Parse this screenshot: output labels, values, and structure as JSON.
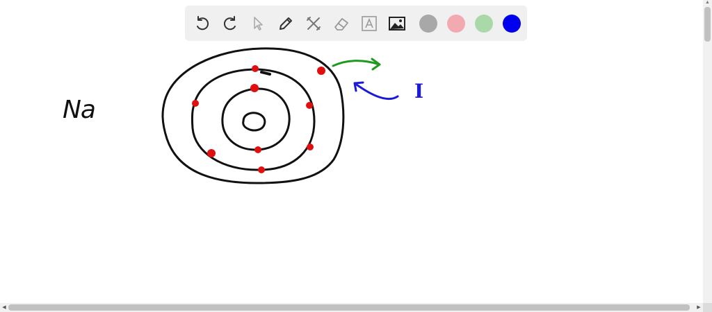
{
  "toolbar": {
    "tools": [
      {
        "name": "undo-icon"
      },
      {
        "name": "redo-icon"
      },
      {
        "name": "pointer-icon"
      },
      {
        "name": "pen-icon"
      },
      {
        "name": "tools-icon"
      },
      {
        "name": "eraser-icon"
      },
      {
        "name": "text-icon"
      },
      {
        "name": "image-icon"
      }
    ],
    "colors": [
      "#a8a8a8",
      "#f3a9b0",
      "#a9d9a9",
      "#0000ee"
    ]
  },
  "canvas": {
    "element_label": "Na",
    "energy_label": "I",
    "ink_colors": {
      "shell": "#111111",
      "electron": "#e01010",
      "arrow_out": "#1f9a1f",
      "arrow_in": "#1a1ad8"
    }
  }
}
